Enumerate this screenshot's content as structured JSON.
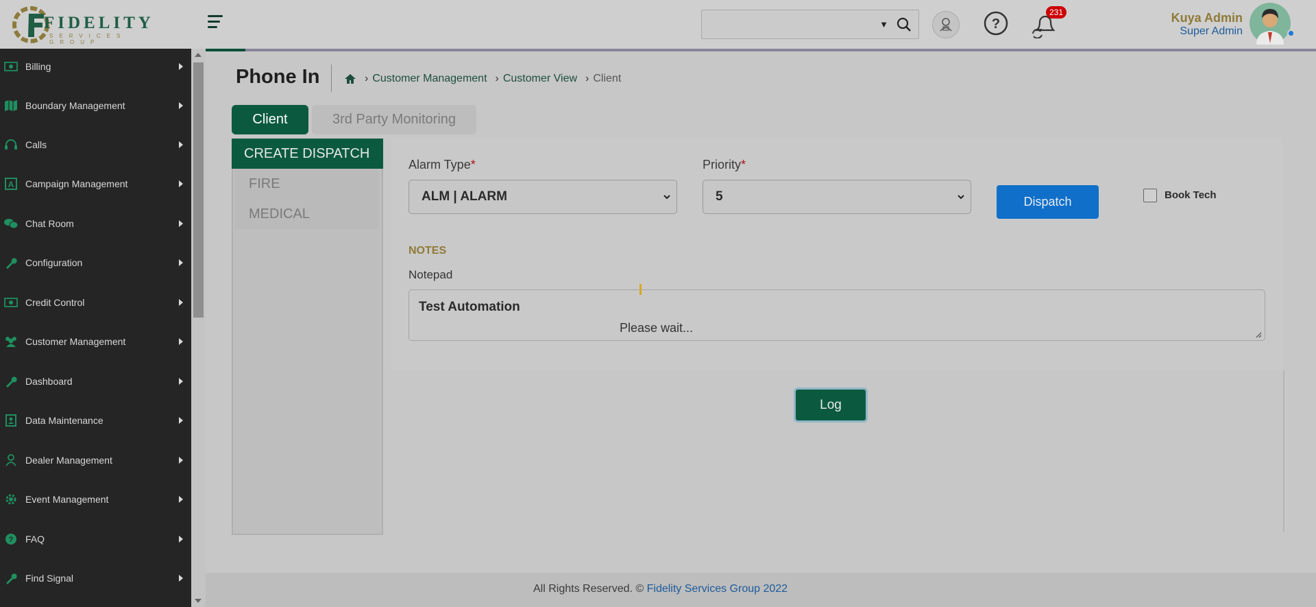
{
  "brand": {
    "logo_word": "FIDELITY",
    "logo_sub": "SERVICES GROUP"
  },
  "header": {
    "search_value": "",
    "notification_count": "231",
    "user_name": "Kuya Admin",
    "user_role": "Super Admin"
  },
  "sidebar": {
    "items": [
      {
        "label": "Billing",
        "icon": "billing-icon"
      },
      {
        "label": "Boundary Management",
        "icon": "map-icon"
      },
      {
        "label": "Calls",
        "icon": "headset-icon"
      },
      {
        "label": "Campaign Management",
        "icon": "campaign-icon"
      },
      {
        "label": "Chat Room",
        "icon": "chat-icon"
      },
      {
        "label": "Configuration",
        "icon": "wrench-icon"
      },
      {
        "label": "Credit Control",
        "icon": "billing-icon"
      },
      {
        "label": "Customer Management",
        "icon": "users-icon"
      },
      {
        "label": "Dashboard",
        "icon": "wrench-icon"
      },
      {
        "label": "Data Maintenance",
        "icon": "id-card-icon"
      },
      {
        "label": "Dealer Management",
        "icon": "user-icon"
      },
      {
        "label": "Event Management",
        "icon": "gear-icon"
      },
      {
        "label": "FAQ",
        "icon": "question-icon"
      },
      {
        "label": "Find Signal",
        "icon": "wrench-icon"
      }
    ]
  },
  "page": {
    "title": "Phone In",
    "breadcrumb": [
      "Customer Management",
      "Customer View",
      "Client"
    ],
    "tabs": [
      "Client",
      "3rd Party Monitoring"
    ]
  },
  "dispatch": {
    "heading": "CREATE DISPATCH",
    "items": [
      "FIRE",
      "MEDICAL"
    ]
  },
  "form": {
    "alarm_type_label": "Alarm Type",
    "alarm_type_value": "ALM | ALARM",
    "priority_label": "Priority",
    "priority_value": "5",
    "required_mark": "*",
    "dispatch_label": "Dispatch",
    "book_tech_label": "Book Tech",
    "notes_heading": "NOTES",
    "notepad_label": "Notepad",
    "notepad_value": "Test Automation",
    "wait_text": "Please wait...",
    "log_label": "Log"
  },
  "footer": {
    "text": "All Rights Reserved. © ",
    "link": "Fidelity Services Group 2022"
  },
  "colors": {
    "brand_green": "#0b5a3f",
    "dispatch_blue": "#0f6fc9",
    "badge_red": "#cc0000",
    "gold": "#8f7a38"
  }
}
